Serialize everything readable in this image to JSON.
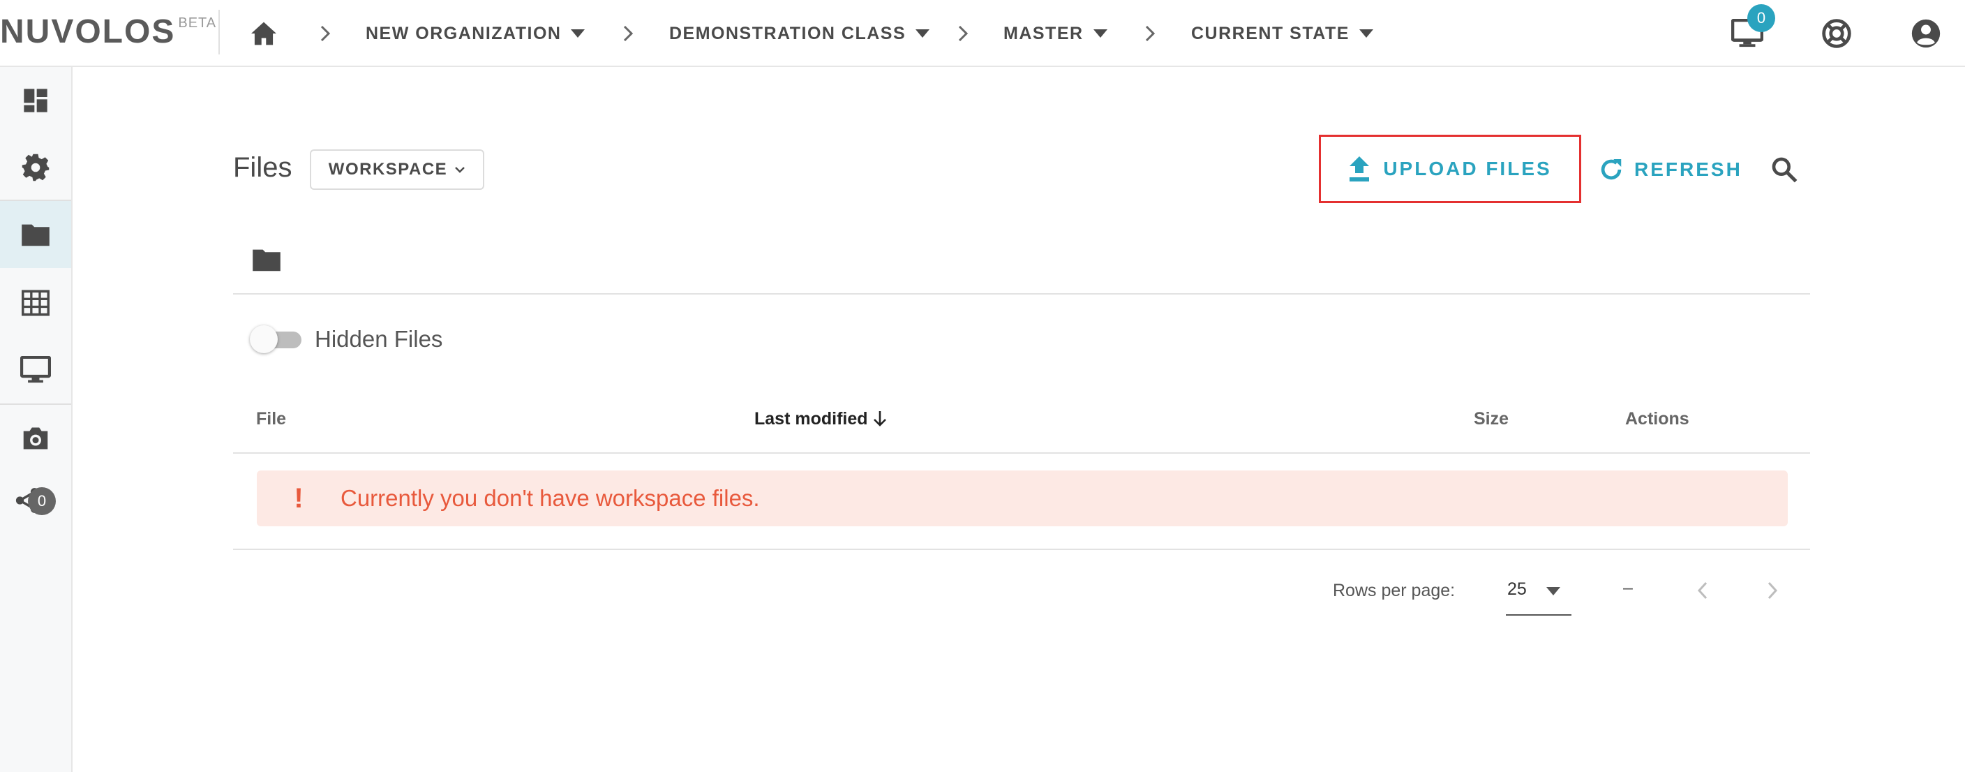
{
  "brand": {
    "name": "NUVOLOS",
    "tag": "BETA"
  },
  "breadcrumbs": [
    {
      "label": "NEW ORGANIZATION"
    },
    {
      "label": "DEMONSTRATION CLASS"
    },
    {
      "label": "MASTER"
    },
    {
      "label": "CURRENT STATE"
    }
  ],
  "topbar": {
    "apps_badge": "0"
  },
  "rail": {
    "share_badge": "0"
  },
  "page": {
    "title": "Files",
    "scope": "WORKSPACE"
  },
  "actions": {
    "upload": "UPLOAD FILES",
    "refresh": "REFRESH"
  },
  "filters": {
    "hidden_files": "Hidden Files",
    "hidden_files_on": false
  },
  "table": {
    "columns": {
      "file": "File",
      "last_modified": "Last modified",
      "size": "Size",
      "actions": "Actions"
    },
    "empty_icon": "!",
    "empty_message": "Currently you don't have workspace files."
  },
  "pagination": {
    "rows_per_page_label": "Rows per page:",
    "rows_per_page": "25",
    "range": "–"
  },
  "colors": {
    "accent": "#2aa3bf",
    "highlight_border": "#e43030",
    "alert_bg": "#fde9e4",
    "alert_text": "#e8593c"
  }
}
